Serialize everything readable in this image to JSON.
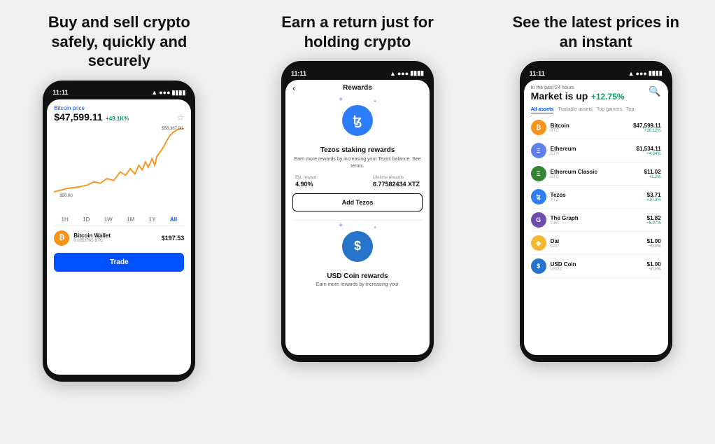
{
  "panel1": {
    "title": "Buy and sell crypto safely, quickly and securely",
    "screen": {
      "time": "11:11",
      "price_label": "Bitcoin price",
      "price": "$47,599.11",
      "change": "+49.1K%",
      "chart_high": "$58,367.00",
      "chart_low": "$50.00",
      "time_filters": [
        "1H",
        "1D",
        "1W",
        "1M",
        "1Y",
        "All"
      ],
      "active_filter": "All",
      "wallet_name": "Bitcoin Wallet",
      "wallet_amount": "$197.53",
      "wallet_btc": "0.0053765 BTC",
      "trade_label": "Trade"
    }
  },
  "panel2": {
    "title": "Earn a return just for holding crypto",
    "screen": {
      "time": "11:11",
      "header_title": "Rewards",
      "tezos_title": "Tezos staking rewards",
      "tezos_desc": "Earn more rewards by increasing your Tezos balance. See terms.",
      "est_reward_label": "Est. reward",
      "est_reward_value": "4.90%",
      "lifetime_label": "Lifetime rewards",
      "lifetime_value": "6.77582434 XTZ",
      "add_tezos_label": "Add Tezos",
      "usdc_title": "USD Coin rewards",
      "usdc_desc": "Earn more rewards by increasing your"
    }
  },
  "panel3": {
    "title": "See the latest prices in an instant",
    "screen": {
      "time": "11:11",
      "market_label": "In the past 24 hours",
      "market_heading": "Market is up",
      "market_change": "+12.75%",
      "filter_tabs": [
        "All assets",
        "Tradable assets",
        "Top gainers",
        "Top"
      ],
      "active_filter": "All assets",
      "assets": [
        {
          "name": "Bitcoin",
          "ticker": "BTC",
          "price": "$47,599.11",
          "change": "+16.12%",
          "color": "#f7931a",
          "symbol": "₿"
        },
        {
          "name": "Ethereum",
          "ticker": "ETH",
          "price": "$1,534.11",
          "change": "+4.34%",
          "color": "#627eea",
          "symbol": "Ξ"
        },
        {
          "name": "Ethereum Classic",
          "ticker": "ETC",
          "price": "$11.02",
          "change": "+1.2%",
          "color": "#328332",
          "symbol": "Ξ"
        },
        {
          "name": "Tezos",
          "ticker": "XTZ",
          "price": "$3.71",
          "change": "+10.3%",
          "color": "#2c7df7",
          "symbol": "ꜩ"
        },
        {
          "name": "The Graph",
          "ticker": "GRT",
          "price": "$1.82",
          "change": "+5.07%",
          "color": "#6f4caf",
          "symbol": "G"
        },
        {
          "name": "Dai",
          "ticker": "DAI",
          "price": "$1.00",
          "change": "+0.0%",
          "color": "#f4b731",
          "symbol": "◈"
        },
        {
          "name": "USD Coin",
          "ticker": "USDC",
          "price": "$1.00",
          "change": "+0.0%",
          "color": "#2775ca",
          "symbol": "$"
        }
      ]
    }
  }
}
